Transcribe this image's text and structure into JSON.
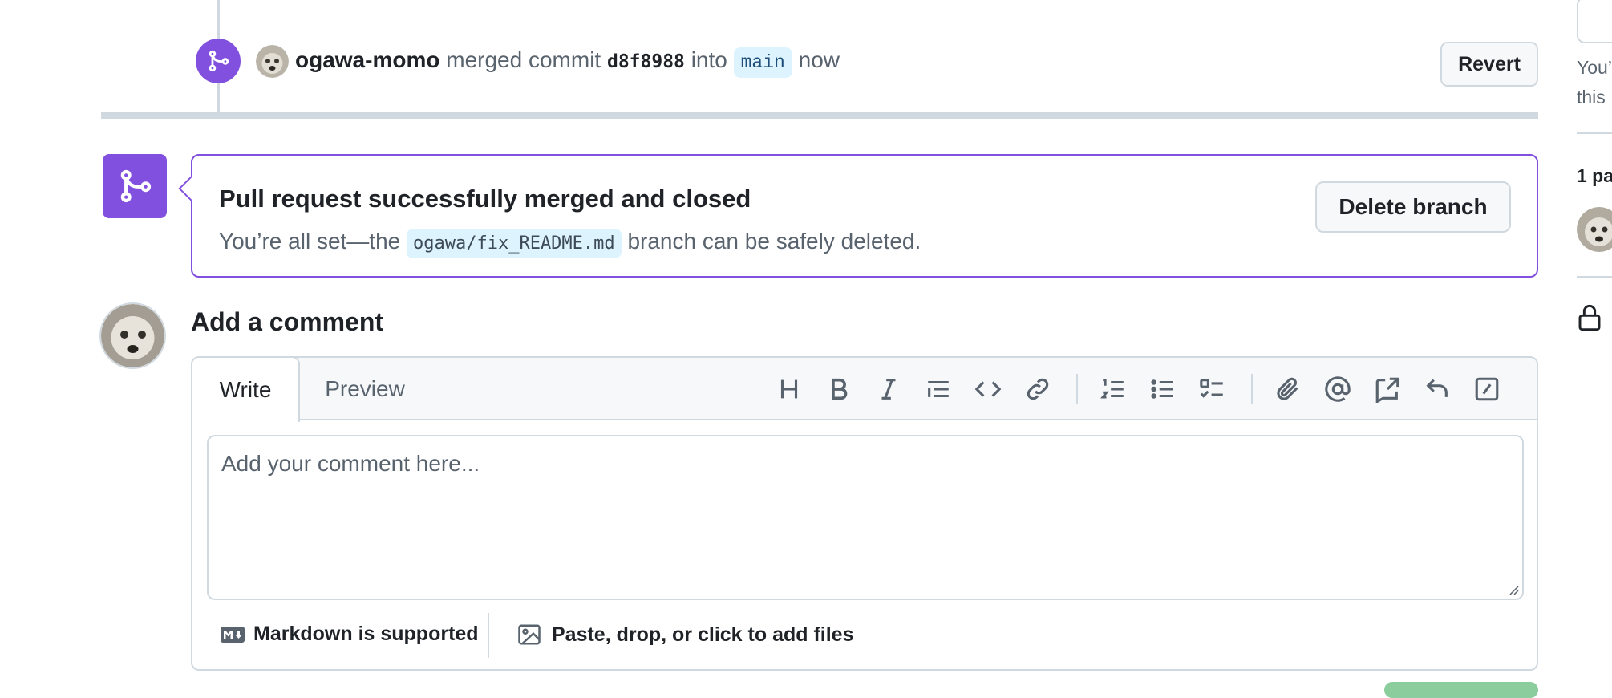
{
  "timeline_event": {
    "user": "ogawa-momo",
    "action": "merged commit",
    "commit_sha": "d8f8988",
    "into_text": "into",
    "target_branch": "main",
    "time": "now",
    "revert_label": "Revert"
  },
  "merged_banner": {
    "title": "Pull request successfully merged and closed",
    "desc_before": "You’re all set—the",
    "branch": "ogawa/fix_README.md",
    "desc_after": "branch can be safely deleted.",
    "delete_label": "Delete branch",
    "accent_color": "#8250df"
  },
  "comment": {
    "heading": "Add a comment",
    "tabs": {
      "write": "Write",
      "preview": "Preview"
    },
    "placeholder": "Add your comment here...",
    "toolbar": [
      "heading-icon",
      "bold-icon",
      "italic-icon",
      "quote-icon",
      "code-icon",
      "link-icon",
      "ordered-list-icon",
      "unordered-list-icon",
      "task-list-icon",
      "attach-icon",
      "mention-icon",
      "cross-reference-icon",
      "saved-reply-icon",
      "slash-commands-icon"
    ],
    "markdown_label": "Markdown is supported",
    "files_label": "Paste, drop, or click to add files"
  },
  "sidebar": {
    "note_line1": "You’",
    "note_line2": "this",
    "participants": "1 pa"
  }
}
